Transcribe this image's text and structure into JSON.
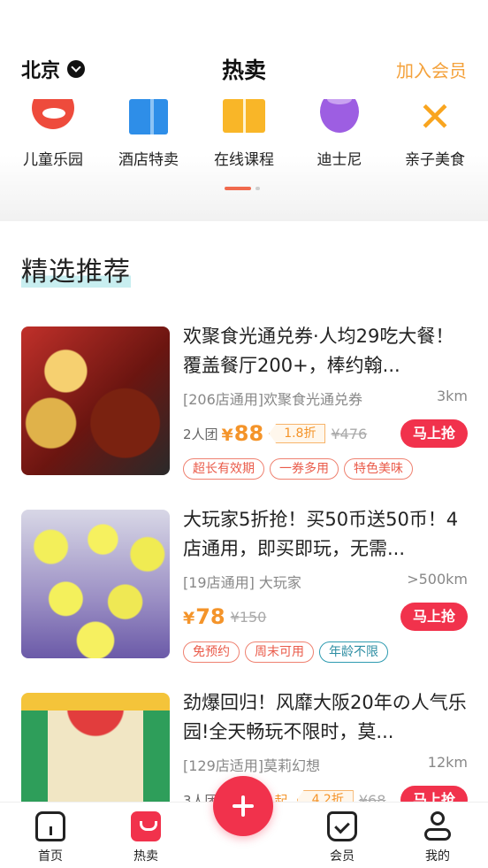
{
  "header": {
    "city": "北京",
    "title": "热卖",
    "join_member": "加入会员"
  },
  "categories": [
    {
      "label": "儿童乐园",
      "icon": "rocking-horse-icon"
    },
    {
      "label": "酒店特卖",
      "icon": "hotel-icon"
    },
    {
      "label": "在线课程",
      "icon": "book-icon"
    },
    {
      "label": "迪士尼",
      "icon": "disney-icon"
    },
    {
      "label": "亲子美食",
      "icon": "food-icon"
    }
  ],
  "section": {
    "title": "精选推荐"
  },
  "deals": [
    {
      "title": "欢聚食光通兑券·人均29吃大餐！覆盖餐厅200+，棒约翰...",
      "subtitle": "[206店通用]欢聚食光通兑券",
      "distance": "3km",
      "group": "2人团",
      "currency": "¥",
      "price": "88",
      "discount": "1.8折",
      "original": "¥476",
      "buy": "马上抢",
      "tags": [
        "超长有效期",
        "一券多用",
        "特色美味"
      ]
    },
    {
      "title": "大玩家5折抢！买50币送50币！4店通用，即买即玩，无需...",
      "subtitle": "[19店通用] 大玩家",
      "distance": ">500km",
      "currency": "¥",
      "price": "78",
      "original": "¥150",
      "buy": "马上抢",
      "tags": [
        "免预约",
        "周末可用",
        "年龄不限"
      ]
    },
    {
      "title": "劲爆回归！风靡大阪20年の人气乐园!全天畅玩不限时，莫...",
      "subtitle": "[129店适用]莫莉幻想",
      "distance": "12km",
      "group": "3人团",
      "price_suffix": "起",
      "discount": "4.2折",
      "original": "¥68",
      "buy": "马上抢"
    }
  ],
  "tabbar": {
    "home": "首页",
    "hot": "热卖",
    "member": "会员",
    "mine": "我的"
  },
  "colors": {
    "accent": "#f1324c",
    "price": "#f4942a",
    "join": "#f4a23c"
  }
}
